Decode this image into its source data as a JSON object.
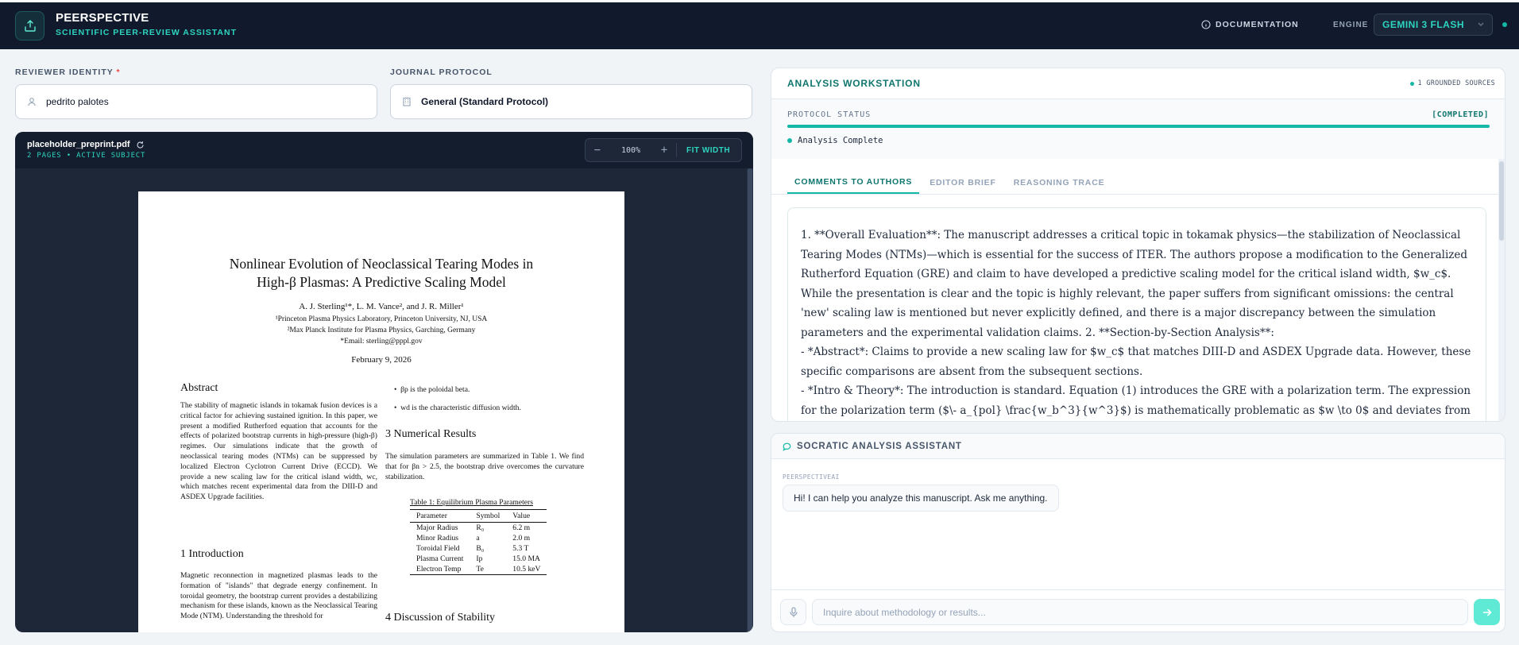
{
  "app": {
    "name": "PEERSPECTIVE",
    "tagline": "SCIENTIFIC PEER-REVIEW ASSISTANT",
    "documentation": "DOCUMENTATION",
    "engine_label": "ENGINE",
    "engine_value": "GEMINI 3 FLASH",
    "accent": "#14b8a6"
  },
  "form": {
    "reviewer_label": "REVIEWER IDENTITY",
    "reviewer_required": "*",
    "reviewer_value": "pedrito palotes",
    "journal_label": "JOURNAL PROTOCOL",
    "journal_value": "General (Standard Protocol)"
  },
  "viewer": {
    "filename": "placeholder_preprint.pdf",
    "meta": "2 PAGES • ACTIVE SUBJECT",
    "zoom_out": "−",
    "zoom": "100%",
    "zoom_in": "+",
    "fit": "FIT WIDTH"
  },
  "paper": {
    "title_line1": "Nonlinear Evolution of Neoclassical Tearing Modes in",
    "title_line2": "High-β Plasmas: A Predictive Scaling Model",
    "authors": "A. J. Sterling¹*, L. M. Vance², and J. R. Miller¹",
    "aff1": "¹Princeton Plasma Physics Laboratory, Princeton University, NJ, USA",
    "aff2": "²Max Planck Institute for Plasma Physics, Garching, Germany",
    "email": "*Email: sterling@pppl.gov",
    "date": "February 9, 2026",
    "abstract_heading": "Abstract",
    "abstract": "The stability of magnetic islands in tokamak fusion devices is a critical factor for achieving sustained ignition. In this paper, we present a modified Rutherford equation that accounts for the effects of polarized bootstrap currents in high-pressure (high-β) regimes. Our simulations indicate that the growth of neoclassical tearing modes (NTMs) can be suppressed by localized Electron Cyclotron Current Drive (ECCD). We provide a new scaling law for the critical island width, wc, which matches recent experimental data from the DIII-D and ASDEX Upgrade facilities.",
    "intro_heading": "1   Introduction",
    "intro": "Magnetic reconnection in magnetized plasmas leads to the formation of \"islands\" that degrade energy confinement. In toroidal geometry, the bootstrap current provides a destabilizing mechanism for these islands, known as the Neoclassical Tearing Mode (NTM). Understanding the threshold for",
    "bullet1": "βp is the poloidal beta.",
    "bullet2": "wd is the characteristic diffusion width.",
    "results_heading": "3   Numerical Results",
    "results": "The simulation parameters are summarized in Table 1. We find that for βn > 2.5, the bootstrap drive overcomes the curvature stabilization.",
    "table_caption": "Table 1: Equilibrium Plasma Parameters",
    "table_headers": [
      "Parameter",
      "Symbol",
      "Value"
    ],
    "table_rows": [
      [
        "Major Radius",
        "R₀",
        "6.2 m"
      ],
      [
        "Minor Radius",
        "a",
        "2.0 m"
      ],
      [
        "Toroidal Field",
        "B₀",
        "5.3 T"
      ],
      [
        "Plasma Current",
        "Ip",
        "15.0 MA"
      ],
      [
        "Electron Temp",
        "Te",
        "10.5 keV"
      ]
    ],
    "discussion_heading": "4   Discussion of Stability"
  },
  "workstation": {
    "title": "ANALYSIS WORKSTATION",
    "sources": "1 GROUNDED SOURCES",
    "protocol_label": "PROTOCOL STATUS",
    "protocol_status": "[COMPLETED]",
    "progress": 1.0,
    "state": "Analysis Complete",
    "tabs": [
      "COMMENTS TO AUTHORS",
      "EDITOR BRIEF",
      "REASONING TRACE"
    ],
    "comments": [
      "1. **Overall Evaluation**: The manuscript addresses a critical topic in tokamak physics—the stabilization of Neoclassical Tearing Modes (NTMs)—which is essential for the success of ITER. The authors propose a modification to the Generalized Rutherford Equation (GRE) and claim to have developed a predictive scaling model for the critical island width, $w_c$. While the presentation is clear and the topic is highly relevant, the paper suffers from significant omissions: the central 'new' scaling law is mentioned but never explicitly defined, and there is a major discrepancy between the simulation parameters and the experimental validation claims. 2. **Section-by-Section Analysis**:",
      "- *Abstract*: Claims to provide a new scaling law for $w_c$ that matches DIII-D and ASDEX Upgrade data. However, these specific comparisons are absent from the subsequent sections.",
      "- *Intro & Theory*: The introduction is standard. Equation (1) introduces the GRE with a polarization term. The expression for the polarization term ($\\- a_{pol} \\frac{w_b^3}{w^3}$) is mathematically problematic as $w \\to 0$ and deviates from"
    ]
  },
  "chat": {
    "title": "SOCRATIC ANALYSIS ASSISTANT",
    "sender": "PEERSPECTIVEAI",
    "message": "Hi! I can help you analyze this manuscript. Ask me anything.",
    "placeholder": "Inquire about methodology or results..."
  }
}
